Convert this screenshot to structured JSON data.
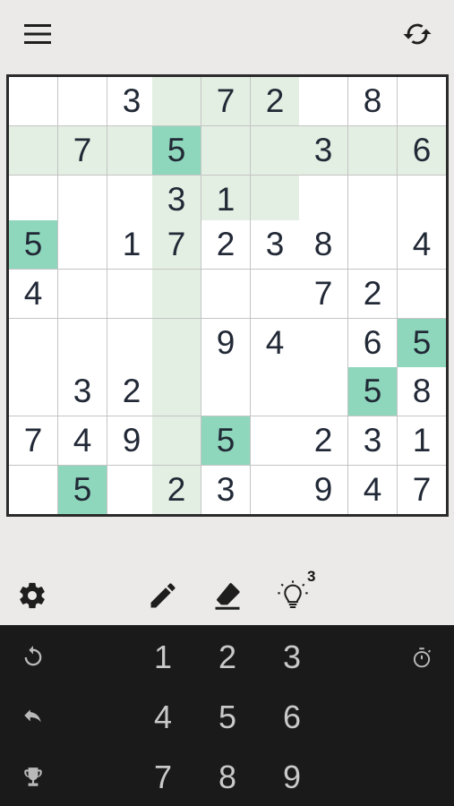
{
  "board": {
    "rows": [
      [
        "",
        "",
        "3",
        "",
        "7",
        "2",
        "",
        "8",
        ""
      ],
      [
        "",
        "7",
        "",
        "5",
        "",
        "",
        "3",
        "",
        "6"
      ],
      [
        "",
        "",
        "",
        "3",
        "1",
        "",
        "",
        "",
        ""
      ],
      [
        "5",
        "",
        "1",
        "7",
        "2",
        "3",
        "8",
        "",
        "4"
      ],
      [
        "4",
        "",
        "",
        "",
        "",
        "",
        "7",
        "2",
        ""
      ],
      [
        "",
        "",
        "",
        "",
        "9",
        "4",
        "",
        "6",
        "5"
      ],
      [
        "",
        "3",
        "2",
        "",
        "",
        "",
        "",
        "5",
        "8"
      ],
      [
        "7",
        "4",
        "9",
        "",
        "5",
        "",
        "2",
        "3",
        "1"
      ],
      [
        "",
        "5",
        "",
        "2",
        "3",
        "",
        "9",
        "4",
        "7"
      ]
    ],
    "selected_cell": {
      "row": 1,
      "col": 3
    },
    "highlight_digit": "5"
  },
  "toolbar": {
    "hint_count": "3"
  },
  "keypad": {
    "numbers": [
      "1",
      "2",
      "3",
      "4",
      "5",
      "6",
      "7",
      "8",
      "9"
    ]
  },
  "colors": {
    "background": "#ebeae8",
    "related_highlight": "#e3efe3",
    "same_digit_highlight": "#8ed7bc",
    "digit": "#222936",
    "keypad_background": "#1a1a1a",
    "keypad_text": "#c9c9c9"
  },
  "icons": {
    "menu": "hamburger-icon",
    "refresh": "refresh-icon",
    "settings": "gear-icon",
    "pencil": "pencil-icon",
    "eraser": "eraser-icon",
    "hint": "lightbulb-icon",
    "restart": "restart-icon",
    "undo": "undo-icon",
    "trophy": "trophy-icon",
    "timer": "stopwatch-icon"
  }
}
